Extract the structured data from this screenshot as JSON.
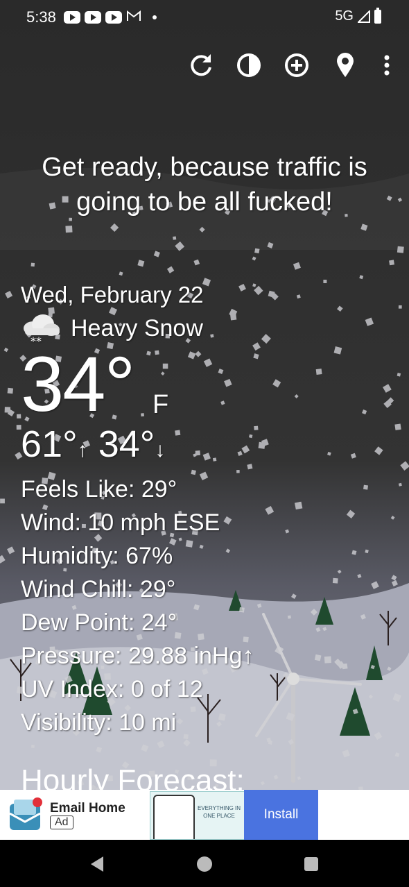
{
  "status_bar": {
    "time": "5:38",
    "network": "5G",
    "notification_icons": [
      "youtube-icon",
      "youtube-icon",
      "youtube-icon",
      "gmail-icon"
    ]
  },
  "toolbar": {
    "buttons": [
      "refresh-icon",
      "theme-icon",
      "add-location-icon",
      "location-pin-icon",
      "more-options-icon"
    ]
  },
  "headline": "Get ready, because traffic is going to be all fucked!",
  "weather": {
    "date": "Wed, February 22",
    "condition": "Heavy Snow",
    "condition_icon": "heavy-snow-icon",
    "temperature": "34°",
    "unit": "F",
    "high": "61°",
    "high_arrow": "↑",
    "low": "34°",
    "low_arrow": "↓",
    "details": [
      {
        "key": "feels_like",
        "text": "Feels Like:  29°"
      },
      {
        "key": "wind",
        "text": "Wind:  10 mph ESE"
      },
      {
        "key": "humidity",
        "text": "Humidity:  67%"
      },
      {
        "key": "wind_chill",
        "text": "Wind Chill:  29°"
      },
      {
        "key": "dew_point",
        "text": "Dew Point:  24°"
      },
      {
        "key": "pressure",
        "text": "Pressure:  29.88 inHg↑"
      },
      {
        "key": "uv_index",
        "text": "UV Index:  0 of 12"
      },
      {
        "key": "visibility",
        "text": "Visibility:  10 mi"
      }
    ]
  },
  "hourly_forecast_title": "Hourly Forecast:",
  "ad": {
    "title": "Email Home",
    "badge": "Ad",
    "preview_text": "EVERYTHING IN ONE PLACE",
    "install_label": "Install",
    "install_color": "#4a73e0"
  },
  "colors": {
    "sky_dark": "#2b2b2b",
    "snow_ground": "#b7b9c6",
    "tree_green": "#1f4a2e"
  }
}
